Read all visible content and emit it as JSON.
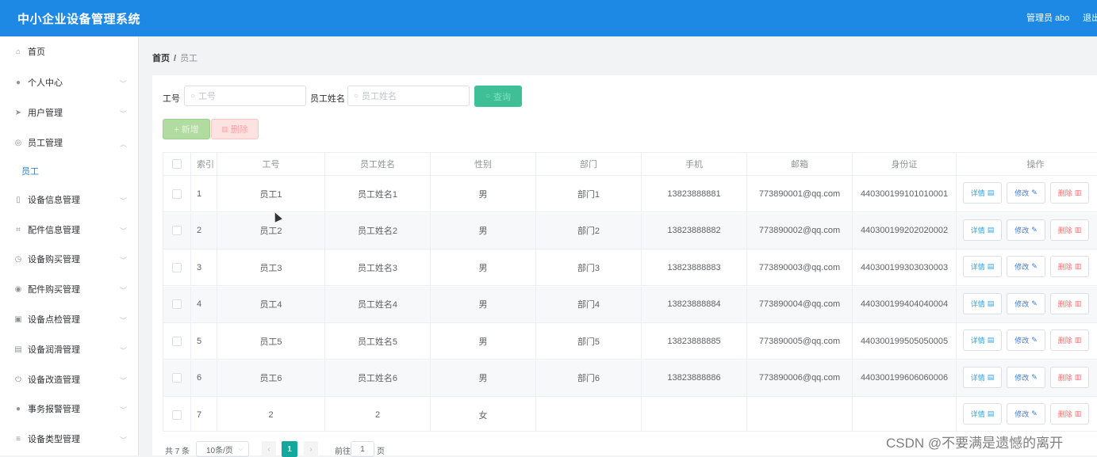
{
  "header": {
    "title": "中小企业设备管理系统",
    "user": "管理员 abo",
    "logout": "退出"
  },
  "sidebar": {
    "items": [
      {
        "label": "首页",
        "icon": "home-icon",
        "glyph": "⌂",
        "chevron": false
      },
      {
        "label": "个人中心",
        "icon": "user-icon",
        "glyph": "●",
        "chevron": true
      },
      {
        "label": "用户管理",
        "icon": "send-icon",
        "glyph": "➤",
        "chevron": true
      },
      {
        "label": "员工管理",
        "icon": "compass-icon",
        "glyph": "◎",
        "chevron": true,
        "expanded": true
      },
      {
        "label": "员工",
        "sub": true
      },
      {
        "label": "设备信息管理",
        "icon": "mic-icon",
        "glyph": "▯",
        "chevron": true
      },
      {
        "label": "配件信息管理",
        "icon": "crop-icon",
        "glyph": "⌗",
        "chevron": true
      },
      {
        "label": "设备购买管理",
        "icon": "clock-icon",
        "glyph": "◷",
        "chevron": true
      },
      {
        "label": "配件购买管理",
        "icon": "target-icon",
        "glyph": "◉",
        "chevron": true
      },
      {
        "label": "设备点检管理",
        "icon": "clipboard-icon",
        "glyph": "▣",
        "chevron": true
      },
      {
        "label": "设备润滑管理",
        "icon": "chart-icon",
        "glyph": "▤",
        "chevron": true
      },
      {
        "label": "设备改造管理",
        "icon": "power-icon",
        "glyph": "⏻",
        "chevron": true
      },
      {
        "label": "事务报警管理",
        "icon": "person-icon",
        "glyph": "●",
        "chevron": true
      },
      {
        "label": "设备类型管理",
        "icon": "list-icon",
        "glyph": "≡",
        "chevron": true
      }
    ]
  },
  "breadcrumb": {
    "home": "首页",
    "sep": "/",
    "current": "员工"
  },
  "search": {
    "id_label": "工号",
    "id_placeholder": "工号",
    "name_label": "员工姓名",
    "name_placeholder": "员工姓名",
    "query_button": "查询"
  },
  "actions": {
    "add": "+ 新增",
    "delete": "删除"
  },
  "table": {
    "headers": [
      "索引",
      "工号",
      "员工姓名",
      "性别",
      "部门",
      "手机",
      "邮箱",
      "身份证",
      "操作"
    ],
    "rows": [
      [
        "1",
        "员工1",
        "员工姓名1",
        "男",
        "部门1",
        "13823888881",
        "773890001@qq.com",
        "440300199101010001"
      ],
      [
        "2",
        "员工2",
        "员工姓名2",
        "男",
        "部门2",
        "13823888882",
        "773890002@qq.com",
        "440300199202020002"
      ],
      [
        "3",
        "员工3",
        "员工姓名3",
        "男",
        "部门3",
        "13823888883",
        "773890003@qq.com",
        "440300199303030003"
      ],
      [
        "4",
        "员工4",
        "员工姓名4",
        "男",
        "部门4",
        "13823888884",
        "773890004@qq.com",
        "440300199404040004"
      ],
      [
        "5",
        "员工5",
        "员工姓名5",
        "男",
        "部门5",
        "13823888885",
        "773890005@qq.com",
        "440300199505050005"
      ],
      [
        "6",
        "员工6",
        "员工姓名6",
        "男",
        "部门6",
        "13823888886",
        "773890006@qq.com",
        "440300199606060006"
      ],
      [
        "7",
        "2",
        "2",
        "女",
        "",
        "",
        "",
        ""
      ]
    ],
    "op_detail": "详情",
    "op_edit": "修改",
    "op_delete": "删除"
  },
  "pagination": {
    "total": "共 7 条",
    "page_size": "10条/页",
    "current": "1",
    "goto_label": "前往",
    "goto_value": "1",
    "page_suffix": "页"
  },
  "watermark": "CSDN @不要满是遗憾的离开",
  "colors": {
    "header_bg": "#1e88e5",
    "query_bg": "#3ebf95",
    "page_active": "#13a89e"
  }
}
